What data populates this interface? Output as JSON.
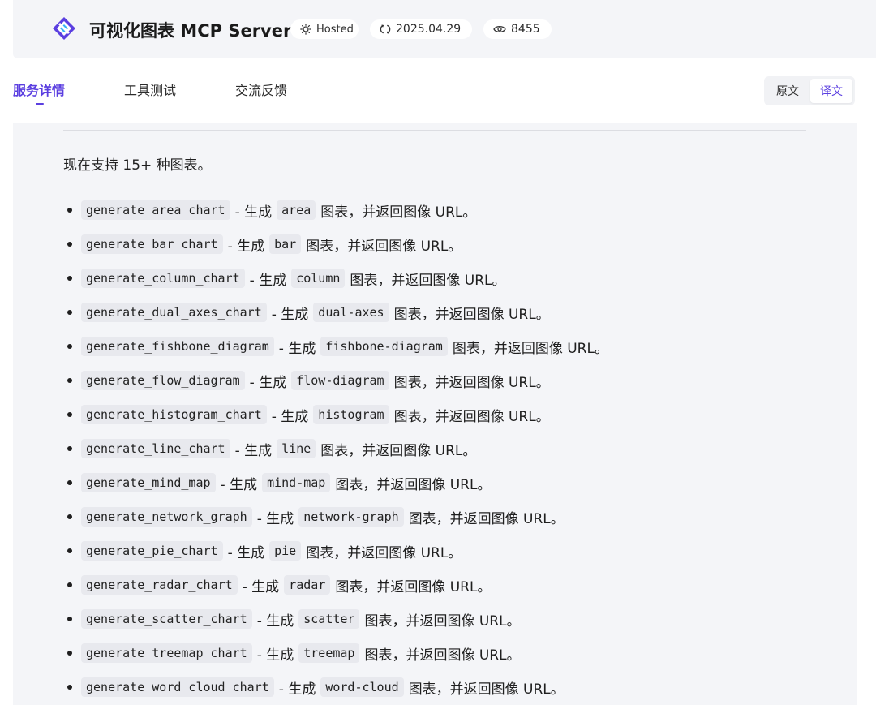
{
  "header": {
    "title": "可视化图表 MCP Server",
    "logo_icon": "diamond-logo-icon",
    "hosted_label": "Hosted",
    "date": "2025.04.29",
    "views": "8455",
    "accent_color": "#5b3fe0"
  },
  "tabs": [
    {
      "label": "服务详情",
      "active": true
    },
    {
      "label": "工具测试",
      "active": false
    },
    {
      "label": "交流反馈",
      "active": false
    }
  ],
  "lang_toggle": {
    "original": "原文",
    "translated": "译文",
    "selected": "译文"
  },
  "content": {
    "intro": "现在支持 15+ 种图表。",
    "tools": [
      {
        "name": "generate_area_chart",
        "sep": "- 生成",
        "type": "area",
        "tail": "图表，并返回图像 URL。"
      },
      {
        "name": "generate_bar_chart",
        "sep": "- 生成",
        "type": "bar",
        "tail": "图表，并返回图像 URL。"
      },
      {
        "name": "generate_column_chart",
        "sep": "- 生成",
        "type": "column",
        "tail": "图表，并返回图像 URL。"
      },
      {
        "name": "generate_dual_axes_chart",
        "sep": "- 生成",
        "type": "dual-axes",
        "tail": "图表，并返回图像 URL。"
      },
      {
        "name": "generate_fishbone_diagram",
        "sep": "- 生成",
        "type": "fishbone-diagram",
        "tail": "图表，并返回图像 URL。"
      },
      {
        "name": "generate_flow_diagram",
        "sep": "- 生成",
        "type": "flow-diagram",
        "tail": "图表，并返回图像 URL。"
      },
      {
        "name": "generate_histogram_chart",
        "sep": "- 生成",
        "type": "histogram",
        "tail": "图表，并返回图像 URL。"
      },
      {
        "name": "generate_line_chart",
        "sep": "- 生成",
        "type": "line",
        "tail": "图表，并返回图像 URL。"
      },
      {
        "name": "generate_mind_map",
        "sep": "- 生成",
        "type": "mind-map",
        "tail": "图表，并返回图像 URL。"
      },
      {
        "name": "generate_network_graph",
        "sep": "- 生成",
        "type": "network-graph",
        "tail": "图表，并返回图像 URL。"
      },
      {
        "name": "generate_pie_chart",
        "sep": "- 生成",
        "type": "pie",
        "tail": "图表，并返回图像 URL。"
      },
      {
        "name": "generate_radar_chart",
        "sep": "- 生成",
        "type": "radar",
        "tail": "图表，并返回图像 URL。"
      },
      {
        "name": "generate_scatter_chart",
        "sep": "- 生成",
        "type": "scatter",
        "tail": "图表，并返回图像 URL。"
      },
      {
        "name": "generate_treemap_chart",
        "sep": "- 生成",
        "type": "treemap",
        "tail": "图表，并返回图像 URL。"
      },
      {
        "name": "generate_word_cloud_chart",
        "sep": "- 生成",
        "type": "word-cloud",
        "tail": "图表，并返回图像 URL。"
      }
    ]
  }
}
